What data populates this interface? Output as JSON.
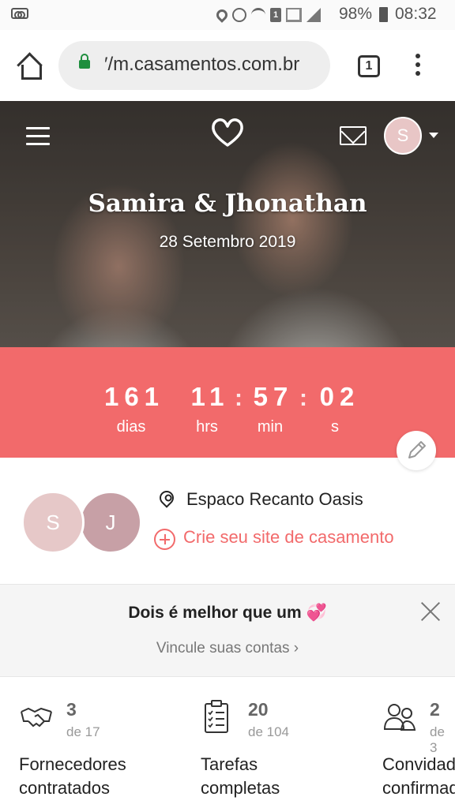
{
  "status_bar": {
    "battery": "98%",
    "time": "08:32",
    "sim_badge": "1"
  },
  "browser": {
    "url": "′/m.casamentos.com.br",
    "tab_count": "1"
  },
  "hero": {
    "couple_names": "Samira & Jhonathan",
    "wedding_date": "28 Setembro 2019",
    "header_avatar_initial": "S"
  },
  "countdown": {
    "days": "161",
    "days_label": "dias",
    "hours": "11",
    "hours_label": "hrs",
    "minutes": "57",
    "minutes_label": "min",
    "seconds": "02",
    "seconds_label": "s",
    "separator": ":"
  },
  "profile": {
    "initial_1": "S",
    "initial_2": "J",
    "venue": "Espaco Recanto Oasis",
    "create_site_link": "Crie seu site de casamento"
  },
  "banner": {
    "title": "Dois é melhor que um 💞",
    "link": "Vincule suas contas ›"
  },
  "stats": [
    {
      "icon": "handshake-icon",
      "count": "3",
      "total": "de 17",
      "label_line1": "Fornecedores",
      "label_line2": "contratados"
    },
    {
      "icon": "clipboard-checklist-icon",
      "count": "20",
      "total": "de 104",
      "label_line1": "Tarefas",
      "label_line2": "completas"
    },
    {
      "icon": "guests-icon",
      "count": "2",
      "total": "de 3",
      "label_line1": "Convidados",
      "label_line2": "confirmados"
    }
  ],
  "colors": {
    "accent": "#f26a6b",
    "avatar_s": "#e6c8c8",
    "avatar_j": "#c7a0a6",
    "lock": "#1e8e3e"
  }
}
